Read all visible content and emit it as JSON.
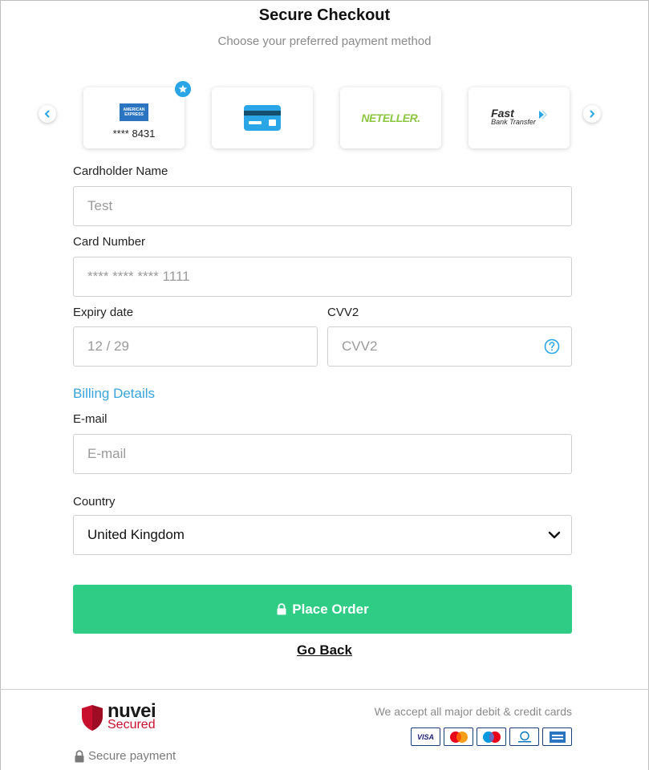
{
  "header": {
    "title": "Secure Checkout",
    "subtitle": "Choose your preferred payment method"
  },
  "payment_methods": [
    {
      "name": "American Express",
      "logo_text": "AMERICAN EXPRESS",
      "masked": "**** 8431",
      "starred": true,
      "icon": "amex-card-icon"
    },
    {
      "name": "Card",
      "icon": "credit-card-icon"
    },
    {
      "name": "Neteller",
      "logo_text": "NETELLER."
    },
    {
      "name": "Fast Bank Transfer",
      "logo_fast": "Fast",
      "logo_sub": "Bank Transfer"
    }
  ],
  "form": {
    "cardholder_label": "Cardholder Name",
    "cardholder_value": "Test",
    "card_number_label": "Card Number",
    "card_number_value": "**** **** **** 1111",
    "expiry_label": "Expiry date",
    "expiry_value": "12 / 29",
    "cvv_label": "CVV2",
    "cvv_placeholder": "CVV2",
    "billing_heading": "Billing Details",
    "email_label": "E-mail",
    "email_placeholder": "E-mail",
    "country_label": "Country",
    "country_value": "United Kingdom"
  },
  "actions": {
    "place_order": "Place Order",
    "go_back": "Go Back"
  },
  "footer": {
    "brand": "nuvei",
    "brand_sub": "Secured",
    "secure_payment": "Secure payment",
    "accept_text": "We accept all major debit & credit cards",
    "accepted_cards": [
      "VISA",
      "Mastercard",
      "Maestro",
      "Diners Club",
      "American Express"
    ]
  },
  "colors": {
    "accent_blue": "#3aa3db",
    "button_green": "#2ecc85",
    "neteller_green": "#8cc63f",
    "nuvei_red": "#c8102e"
  }
}
